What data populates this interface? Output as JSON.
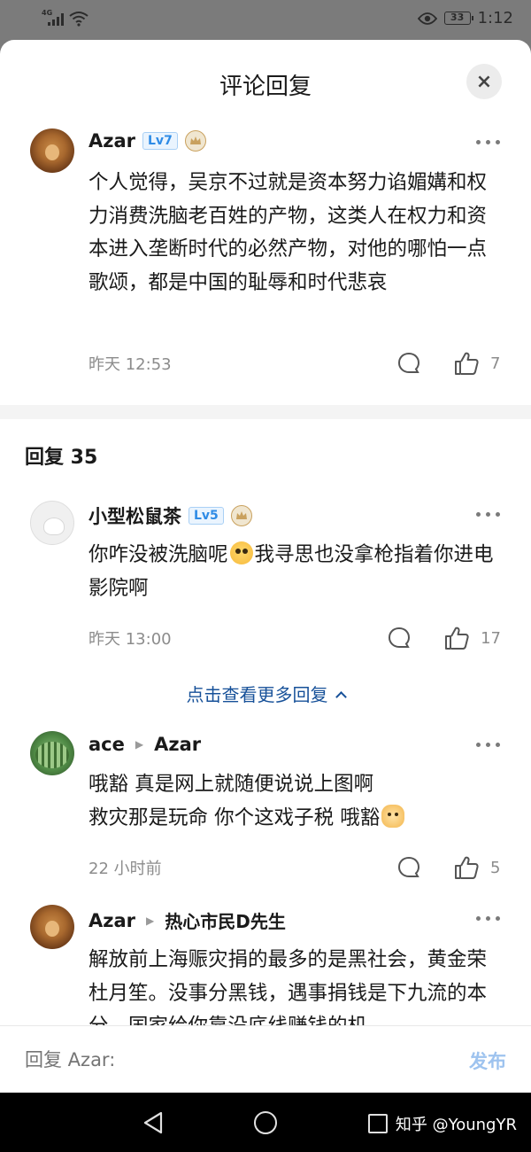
{
  "status_bar": {
    "network": "4G",
    "battery": "33",
    "time": "1:12"
  },
  "sheet": {
    "title": "评论回复",
    "close_label": "×"
  },
  "main_comment": {
    "username": "Azar",
    "level": "Lv7",
    "text": "个人觉得，吴京不过就是资本努力谄媚媾和权力消费洗脑老百姓的产物，这类人在权力和资本进入垄断时代的必然产物，对他的哪怕一点歌颂，都是中国的耻辱和时代悲哀",
    "time": "昨天 12:53",
    "likes": "7"
  },
  "replies_header": "回复 35",
  "replies": [
    {
      "username": "小型松鼠茶",
      "level": "Lv5",
      "text_before_emoji": "你咋没被洗脑呢",
      "text_after_emoji": "我寻思也没拿枪指着你进电影院啊",
      "time": "昨天 13:00",
      "likes": "17"
    },
    {
      "username": "ace",
      "reply_to": "Azar",
      "line1": "哦豁 真是网上就随便说说上图啊",
      "line2_before_emoji": "救灾那是玩命 你个这戏子税 哦豁",
      "time": "22 小时前",
      "likes": "5"
    },
    {
      "username": "Azar",
      "reply_to": "热心市民D先生",
      "text": "解放前上海赈灾捐的最多的是黑社会，黄金荣杜月笙。没事分黑钱，遇事捐钱是下九流的本分。国家给你靠没底线赚钱的机"
    }
  ],
  "more_replies_label": "点击查看更多回复",
  "reply_bar": {
    "placeholder": "回复 Azar:",
    "publish": "发布"
  },
  "watermark": "知乎 @YoungYR",
  "colors": {
    "link_blue": "#175199",
    "level_blue": "#2e8be6",
    "publish_disabled": "#9ec3ef"
  }
}
